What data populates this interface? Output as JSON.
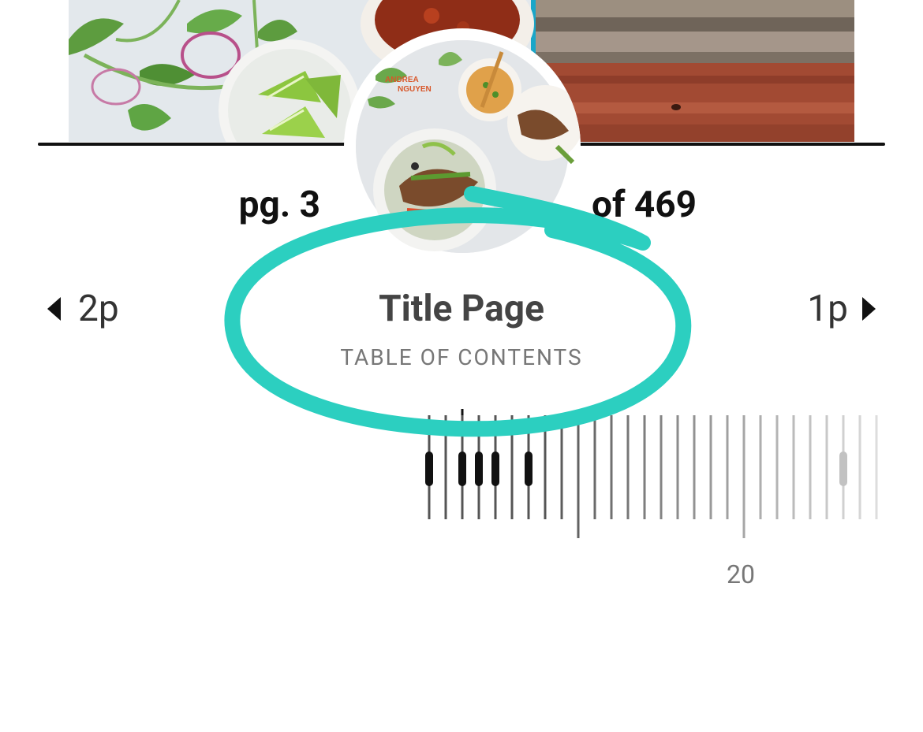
{
  "page_indicator": {
    "current": "pg. 3",
    "total": "of 469"
  },
  "section": {
    "title": "Title Page",
    "subtitle": "TABLE OF CONTENTS"
  },
  "nav": {
    "prev_label": "2p",
    "next_label": "1p"
  },
  "ruler": {
    "tick_label": "20",
    "visible_pages": 28,
    "current_page": 3,
    "marked_pages": [
      1,
      3,
      4,
      5,
      7
    ],
    "highlight_page": 26,
    "major_tick_pages": [
      10,
      20
    ]
  },
  "thumbnail": {
    "author_line1": "ANDREA",
    "author_line2": "NGUYEN"
  },
  "colors": {
    "annotation_teal": "#2ccfc0",
    "text_dark": "#111111",
    "text_muted": "#777777"
  }
}
